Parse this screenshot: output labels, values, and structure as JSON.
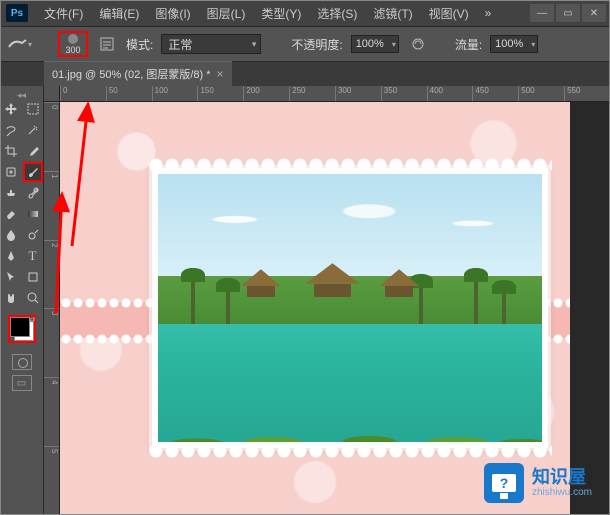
{
  "app_logo": "Ps",
  "menu": {
    "file": "文件(F)",
    "edit": "编辑(E)",
    "image": "图像(I)",
    "layer": "图层(L)",
    "type": "类型(Y)",
    "select": "选择(S)",
    "filter": "滤镜(T)",
    "view": "视图(V)"
  },
  "window_controls": {
    "min": "—",
    "max": "▭",
    "close": "✕"
  },
  "options": {
    "brush_size": "300",
    "mode_label": "模式:",
    "mode_value": "正常",
    "opacity_label": "不透明度:",
    "opacity_value": "100%",
    "flow_label": "流量:",
    "flow_value": "100%"
  },
  "document": {
    "tab_title": "01.jpg @ 50% (02, 图层蒙版/8) *",
    "close_glyph": "×"
  },
  "ruler_h": [
    "0",
    "50",
    "100",
    "150",
    "200",
    "250",
    "300",
    "350",
    "400",
    "450",
    "500",
    "550"
  ],
  "ruler_v": [
    "0",
    "1",
    "2",
    "3",
    "4",
    "5"
  ],
  "watermark": {
    "glyph": "?",
    "title": "知识屋",
    "url": "zhishiwu.com"
  },
  "colors": {
    "fg": "#000000",
    "bg": "#ffffff"
  }
}
